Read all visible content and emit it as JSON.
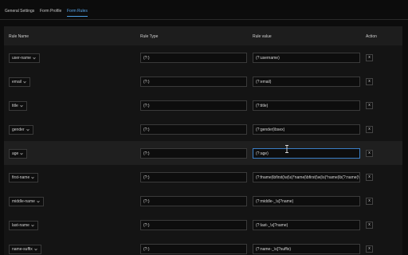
{
  "tabs": [
    {
      "label": "General Settings",
      "active": false
    },
    {
      "label": "Form Profile",
      "active": false
    },
    {
      "label": "Form Rules",
      "active": true
    }
  ],
  "table": {
    "headers": {
      "rule_name": "Rule Name",
      "rule_type": "Rule Type",
      "rule_value": "Rule value",
      "action": "Action"
    },
    "rows": [
      {
        "name": "user-name",
        "type": "(?:)",
        "value": "(?:username)",
        "action": "x"
      },
      {
        "name": "email",
        "type": "(?:)",
        "value": "(?:email)",
        "action": "x"
      },
      {
        "name": "title",
        "type": "(?:)",
        "value": "(?:title)",
        "action": "x"
      },
      {
        "name": "gender",
        "type": "(?:)",
        "value": "(?:gender|\\bsex)",
        "action": "x"
      },
      {
        "name": "age",
        "type": "(?:)",
        "value": "(?:age)",
        "action": "x",
        "hover": true
      },
      {
        "name": "first-name",
        "type": "(?:)",
        "value": "(?:fname|\\bfirst(\\w|\\s)*name|\\bfirst(\\w|\\s)*name|\\b(?:name(\\w|",
        "action": "x"
      },
      {
        "name": "middle-name",
        "type": "(?:)",
        "value": "(?:middle-_\\s]?name)",
        "action": "x"
      },
      {
        "name": "last-name",
        "type": "(?:)",
        "value": "(?:last-_\\s]?name)",
        "action": "x"
      },
      {
        "name": "name-suffix",
        "type": "(?:)",
        "value": "(?:name-_\\s]?suffix)",
        "action": "x"
      }
    ]
  },
  "icons": {
    "dropdown": "chevron-down-icon",
    "cursor": "text-cursor-icon"
  },
  "colors": {
    "accent": "#5aa8ee",
    "background": "#0c0c0c",
    "table": "#161616"
  }
}
